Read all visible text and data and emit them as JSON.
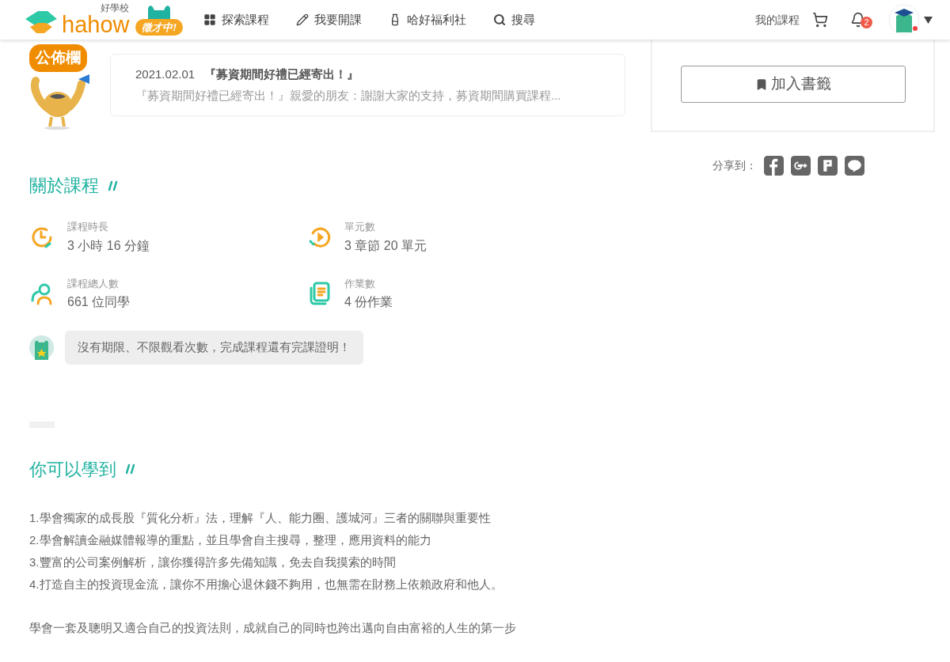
{
  "header": {
    "logo_text": "hahow",
    "logo_subtitle": "好學校",
    "hiring_badge": "徵才中!",
    "nav": [
      {
        "kind": "grid",
        "label": "探索課程"
      },
      {
        "kind": "pencil",
        "label": "我要開課"
      },
      {
        "kind": "bottle",
        "label": "哈好福利社"
      },
      {
        "kind": "search",
        "label": "搜尋"
      }
    ],
    "my_courses": "我的課程",
    "notification_count": "2"
  },
  "bulletin": {
    "badge": "公佈欄",
    "date": "2021.02.01",
    "title": "『募資期間好禮已經寄出！』",
    "excerpt": "『募資期間好禮已經寄出！』親愛的朋友：謝謝大家的支持，募資期間購買課程..."
  },
  "sidebar": {
    "bookmark_button": "加入書籤",
    "share_label": "分享到：",
    "share": [
      {
        "kind": "facebook"
      },
      {
        "kind": "googleplus"
      },
      {
        "kind": "plurk"
      },
      {
        "kind": "line"
      }
    ]
  },
  "about": {
    "heading": "關於課程",
    "stats": [
      {
        "kind": "clock",
        "label": "課程時長",
        "value": "3 小時 16 分鐘"
      },
      {
        "kind": "play",
        "label": "單元數",
        "value": "3 章節 20 單元"
      },
      {
        "kind": "people",
        "label": "課程總人數",
        "value": "661 位同學"
      },
      {
        "kind": "document",
        "label": "作業數",
        "value": "4 份作業"
      }
    ],
    "note": "沒有期限、不限觀看次數，完成課程還有完課證明！"
  },
  "learn": {
    "heading": "你可以學到",
    "items": [
      "1.學會獨家的成長股『質化分析』法，理解『人、能力圈、護城河』三者的關聯與重要性",
      "2.學會解讀金融媒體報導的重點，並且學會自主搜尋，整理，應用資料的能力",
      "3.豐富的公司案例解析，讓你獲得許多先備知識，免去自我摸索的時間",
      "4.打造自主的投資現金流，讓你不用擔心退休錢不夠用，也無需在財務上依賴政府和他人。"
    ],
    "summary": "學會一套及聰明又適合自己的投資法則，成就自己的同時也跨出邁向自由富裕的人生的第一步"
  }
}
